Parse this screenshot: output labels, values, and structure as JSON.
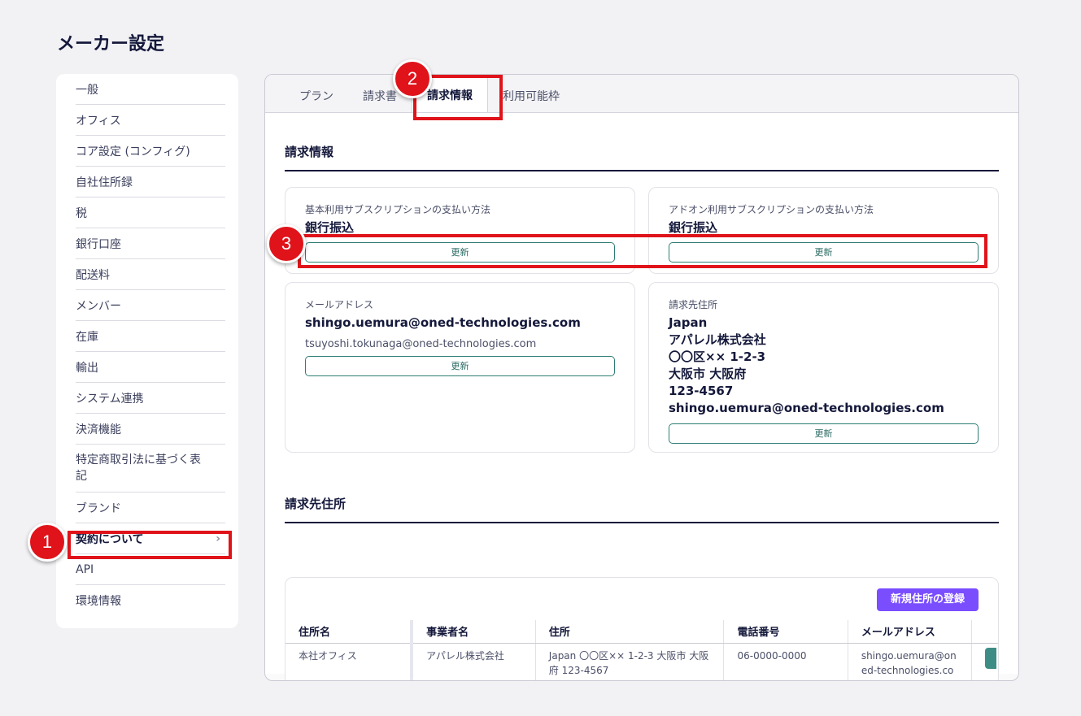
{
  "page_title": "メーカー設定",
  "sidebar": {
    "items": [
      {
        "label": "一般"
      },
      {
        "label": "オフィス"
      },
      {
        "label": "コア設定 (コンフィグ)"
      },
      {
        "label": "自社住所録"
      },
      {
        "label": "税"
      },
      {
        "label": "銀行口座"
      },
      {
        "label": "配送料"
      },
      {
        "label": "メンバー"
      },
      {
        "label": "在庫"
      },
      {
        "label": "輸出"
      },
      {
        "label": "システム連携"
      },
      {
        "label": "決済機能"
      },
      {
        "label": "特定商取引法に基づく表記"
      },
      {
        "label": "ブランド"
      },
      {
        "label": "契約について",
        "active": true
      },
      {
        "label": "API"
      },
      {
        "label": "環境情報"
      }
    ]
  },
  "tabs": [
    "プラン",
    "請求書",
    "請求情報",
    "利用可能枠"
  ],
  "billing": {
    "section_title": "請求情報",
    "basic_sub": {
      "label": "基本利用サブスクリプションの支払い方法",
      "value": "銀行振込",
      "button": "更新"
    },
    "addon_sub": {
      "label": "アドオン利用サブスクリプションの支払い方法",
      "value": "銀行振込",
      "button": "更新"
    },
    "email": {
      "label": "メールアドレス",
      "primary": "shingo.uemura@oned-technologies.com",
      "secondary": "tsuyoshi.tokunaga@oned-technologies.com",
      "button": "更新"
    },
    "address": {
      "label": "請求先住所",
      "lines": [
        "Japan",
        "アパレル株式会社",
        "〇〇区×× 1-2-3",
        "大阪市 大阪府",
        "123-4567",
        "shingo.uemura@oned-technologies.com"
      ],
      "button": "更新"
    }
  },
  "addresses": {
    "section_title": "請求先住所",
    "new_button": "新規住所の登録",
    "columns": [
      "住所名",
      "事業者名",
      "住所",
      "電話番号",
      "メールアドレス"
    ],
    "rows": [
      {
        "name": "本社オフィス",
        "company": "アパレル株式会社",
        "address": "Japan 〇〇区×× 1-2-3 大阪市 大阪府 123-4567",
        "phone": "06-0000-0000",
        "email": "shingo.uemura@oned-technologies.com"
      }
    ]
  },
  "annotations": {
    "step1": "1",
    "step2": "2",
    "step3": "3"
  },
  "colors": {
    "highlight": "#e0131a",
    "primary_button": "#7a4dff",
    "outline_button": "#2e7d73"
  }
}
